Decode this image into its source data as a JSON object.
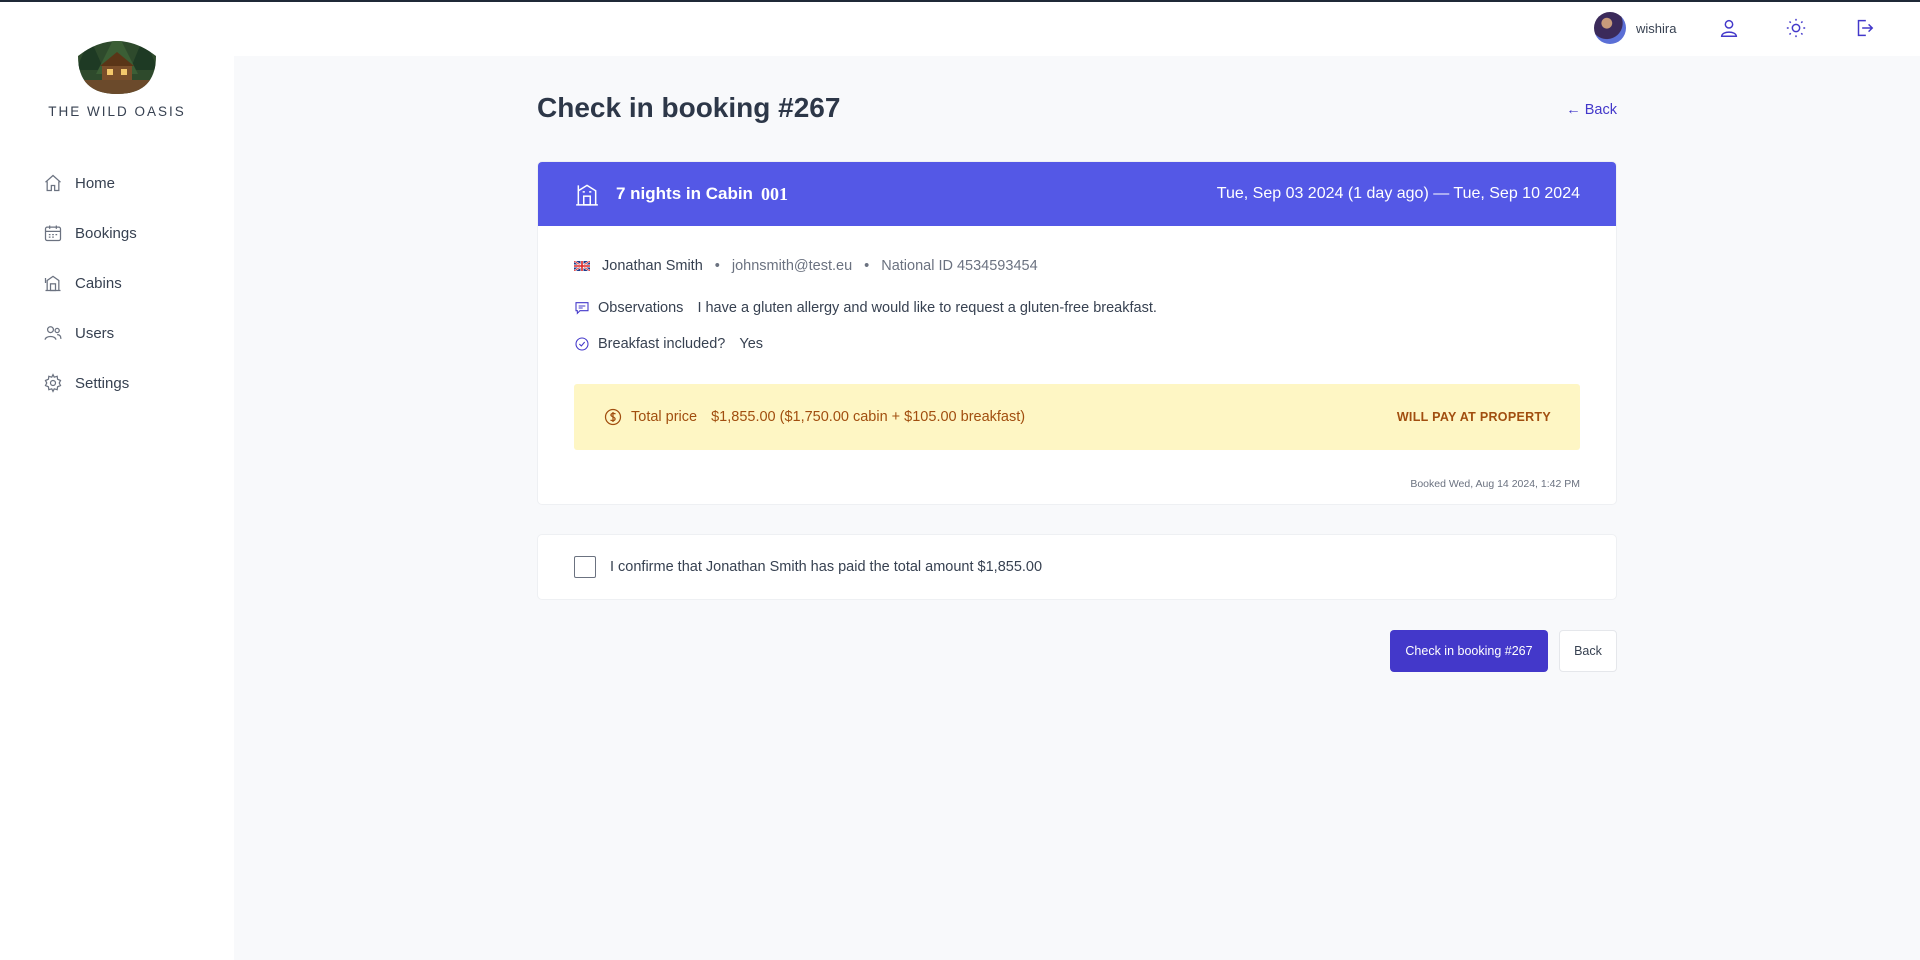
{
  "brand": {
    "name": "THE WILD OASIS"
  },
  "sidebar": {
    "items": [
      {
        "label": "Home",
        "icon": "home-icon"
      },
      {
        "label": "Bookings",
        "icon": "calendar-icon"
      },
      {
        "label": "Cabins",
        "icon": "cabin-icon"
      },
      {
        "label": "Users",
        "icon": "users-icon"
      },
      {
        "label": "Settings",
        "icon": "gear-icon"
      }
    ]
  },
  "header": {
    "username": "wishira",
    "icons": [
      "user-icon",
      "sun-icon",
      "logout-icon"
    ]
  },
  "page": {
    "title": "Check in booking #267",
    "back_link": "← Back"
  },
  "booking": {
    "nights_label": "7 nights in Cabin",
    "cabin_number": "001",
    "dates": "Tue, Sep 03 2024 (1 day ago) — Tue, Sep 10 2024",
    "guest": {
      "name": "Jonathan Smith",
      "email": "johnsmith@test.eu",
      "national_id": "National ID 4534593454",
      "separator": "•"
    },
    "observations_label": "Observations",
    "observations": "I have a gluten allergy and would like to request a gluten-free breakfast.",
    "breakfast_label": "Breakfast included?",
    "breakfast_value": "Yes",
    "price_label": "Total price",
    "price_value": "$1,855.00 ($1,750.00 cabin + $105.00 breakfast)",
    "payment_status": "WILL PAY AT PROPERTY",
    "booked_at": "Booked Wed, Aug 14 2024, 1:42 PM"
  },
  "confirm": {
    "text": "I confirme that Jonathan Smith has paid the total amount $1,855.00",
    "checked": false
  },
  "actions": {
    "checkin_label": "Check in booking #267",
    "back_label": "Back"
  },
  "colors": {
    "accent": "#4338ca",
    "banner": "#5458e6",
    "price_bg": "#fef6c4",
    "price_text": "#a14e0f"
  }
}
